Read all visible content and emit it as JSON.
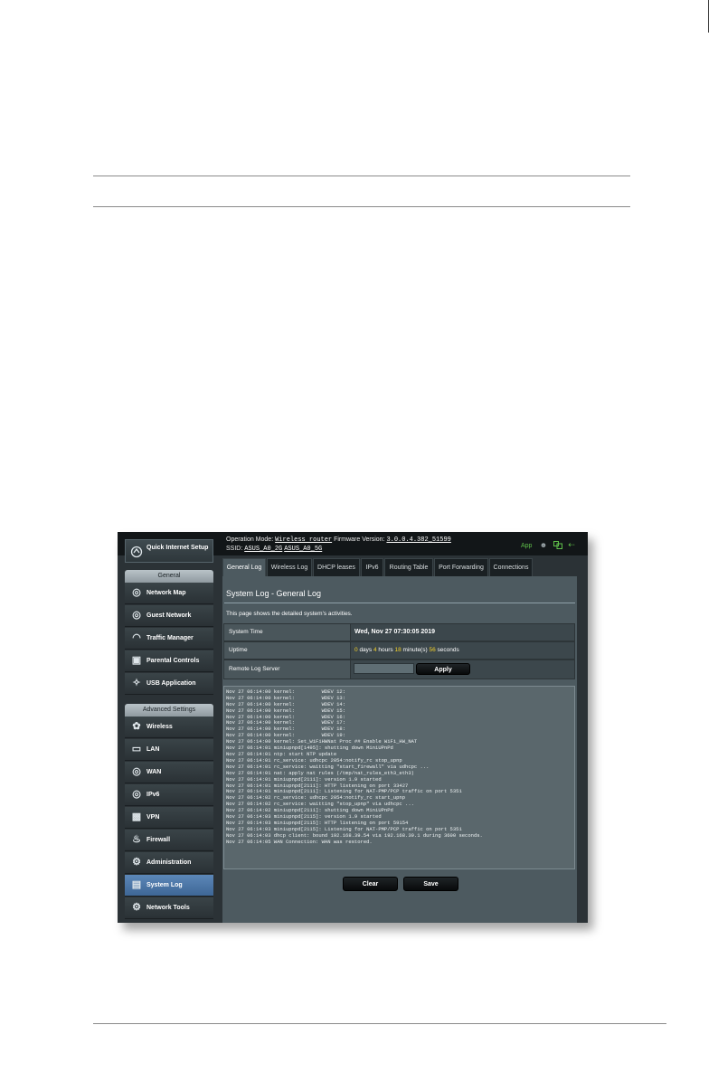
{
  "topbar": {
    "op_mode_label": "Operation Mode:",
    "op_mode_value": "Wireless router",
    "fw_label": "Firmware Version:",
    "fw_value": "3.0.0.4.382_51599",
    "ssid_label": "SSID:",
    "ssid_values": [
      "ASUS_A0_2G",
      "ASUS_A0_5G"
    ],
    "app_label": "App"
  },
  "sidebar": {
    "quick_setup": "Quick Internet Setup",
    "general_header": "General",
    "general_items": [
      {
        "label": "Network Map",
        "icon": "globe-icon"
      },
      {
        "label": "Guest Network",
        "icon": "guest-icon"
      },
      {
        "label": "Traffic Manager",
        "icon": "gauge-icon"
      },
      {
        "label": "Parental Controls",
        "icon": "lock-icon"
      },
      {
        "label": "USB Application",
        "icon": "puzzle-icon"
      }
    ],
    "advanced_header": "Advanced Settings",
    "advanced_items": [
      {
        "label": "Wireless",
        "icon": "wifi-icon"
      },
      {
        "label": "LAN",
        "icon": "monitor-icon"
      },
      {
        "label": "WAN",
        "icon": "globe-icon"
      },
      {
        "label": "IPv6",
        "icon": "globe-icon"
      },
      {
        "label": "VPN",
        "icon": "vpn-icon"
      },
      {
        "label": "Firewall",
        "icon": "fire-icon"
      },
      {
        "label": "Administration",
        "icon": "admin-icon"
      },
      {
        "label": "System Log",
        "icon": "log-icon",
        "active": true
      },
      {
        "label": "Network Tools",
        "icon": "gear-icon"
      }
    ]
  },
  "tabs": [
    {
      "label": "General Log",
      "active": true
    },
    {
      "label": "Wireless Log"
    },
    {
      "label": "DHCP leases"
    },
    {
      "label": "IPv6"
    },
    {
      "label": "Routing Table"
    },
    {
      "label": "Port Forwarding"
    },
    {
      "label": "Connections"
    }
  ],
  "content": {
    "title": "System Log - General Log",
    "description": "This page shows the detailed system's activities.",
    "system_time_label": "System Time",
    "system_time_value": "Wed, Nov 27 07:30:05 2019",
    "uptime_label": "Uptime",
    "uptime": {
      "days": "0",
      "days_label": "days",
      "hours": "4",
      "hours_label": "hours",
      "minutes": "18",
      "minutes_label": "minute(s)",
      "seconds": "56",
      "seconds_label": "seconds"
    },
    "remote_log_label": "Remote Log Server",
    "remote_log_value": "",
    "apply_label": "Apply",
    "log_lines": [
      "Nov 27 06:14:00 kernel:         WDEV 11:",
      "Nov 27 06:14:00 kernel:         WDEV 12:",
      "Nov 27 06:14:00 kernel:         WDEV 13:",
      "Nov 27 06:14:00 kernel:         WDEV 14:",
      "Nov 27 06:14:00 kernel:         WDEV 15:",
      "Nov 27 06:14:00 kernel:         WDEV 16:",
      "Nov 27 06:14:00 kernel:         WDEV 17:",
      "Nov 27 06:14:00 kernel:         WDEV 18:",
      "Nov 27 06:14:00 kernel:         WDEV 19:",
      "Nov 27 06:14:00 kernel: Set_WiFiHWNat Proc ## Enable WiFi_HW_NAT",
      "Nov 27 06:14:01 miniupnpd[1495]: shutting down MiniUPnPd",
      "Nov 27 06:14:01 ntp: start NTP update",
      "Nov 27 06:14:01 rc_service: udhcpc 2054:notify_rc stop_upnp",
      "Nov 27 06:14:01 rc_service: waitting \"start_firewall\" via udhcpc ...",
      "Nov 27 06:14:01 nat: apply nat rules (/tmp/nat_rules_eth3_eth3)",
      "Nov 27 06:14:01 miniupnpd[2111]: version 1.9 started",
      "Nov 27 06:14:01 miniupnpd[2111]: HTTP listening on port 33427",
      "Nov 27 06:14:01 miniupnpd[2111]: Listening for NAT-PMP/PCP traffic on port 5351",
      "Nov 27 06:14:02 rc_service: udhcpc 2054:notify_rc start_upnp",
      "Nov 27 06:14:02 rc_service: waitting \"stop_upnp\" via udhcpc ...",
      "Nov 27 06:14:02 miniupnpd[2111]: shutting down MiniUPnPd",
      "Nov 27 06:14:03 miniupnpd[2115]: version 1.9 started",
      "Nov 27 06:14:03 miniupnpd[2115]: HTTP listening on port 59154",
      "Nov 27 06:14:03 miniupnpd[2115]: Listening for NAT-PMP/PCP traffic on port 5351",
      "Nov 27 06:14:03 dhcp client: bound 192.168.39.54 via 192.168.39.1 during 3600 seconds.",
      "Nov 27 06:14:05 WAN Connection: WAN was restored."
    ],
    "clear_label": "Clear",
    "save_label": "Save"
  },
  "colors": {
    "highlight_yellow": "#f3d12b",
    "app_green": "#5fbf4a",
    "active_nav_blue": "#4f7aaa"
  }
}
